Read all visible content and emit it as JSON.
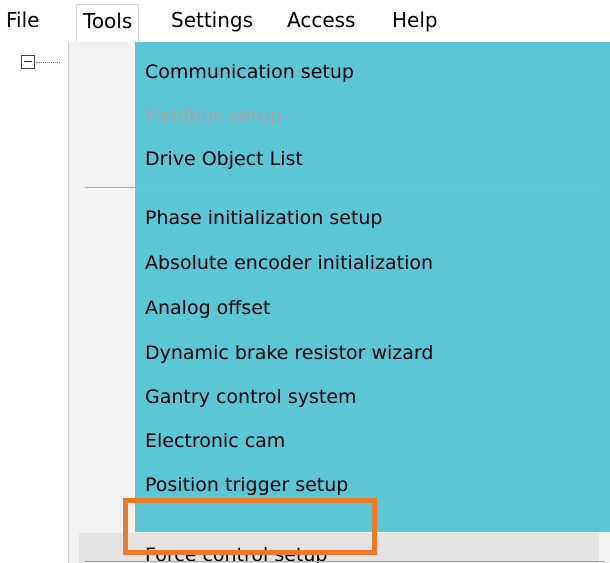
{
  "menubar": {
    "items": [
      {
        "label": "File"
      },
      {
        "label": "Tools"
      },
      {
        "label": "Settings"
      },
      {
        "label": "Access"
      },
      {
        "label": "Help"
      }
    ]
  },
  "tools_menu": {
    "items": [
      {
        "label": "Communication setup",
        "enabled": true
      },
      {
        "label": "Fieldbus setup",
        "enabled": false
      },
      {
        "label": "Drive Object List",
        "enabled": true
      },
      {
        "label": "Phase initialization setup",
        "enabled": true
      },
      {
        "label": "Absolute encoder initialization",
        "enabled": true
      },
      {
        "label": "Analog offset",
        "enabled": true
      },
      {
        "label": "Dynamic brake resistor wizard",
        "enabled": true
      },
      {
        "label": "Gantry control system",
        "enabled": true
      },
      {
        "label": "Electronic cam",
        "enabled": true
      },
      {
        "label": "Position trigger setup",
        "enabled": true
      },
      {
        "label": "Force control setup",
        "enabled": true
      }
    ]
  },
  "colors": {
    "menu_highlight": "#5bc6d6",
    "focus_outline": "#ec7a26",
    "disabled_text": "#a4a4a4"
  }
}
